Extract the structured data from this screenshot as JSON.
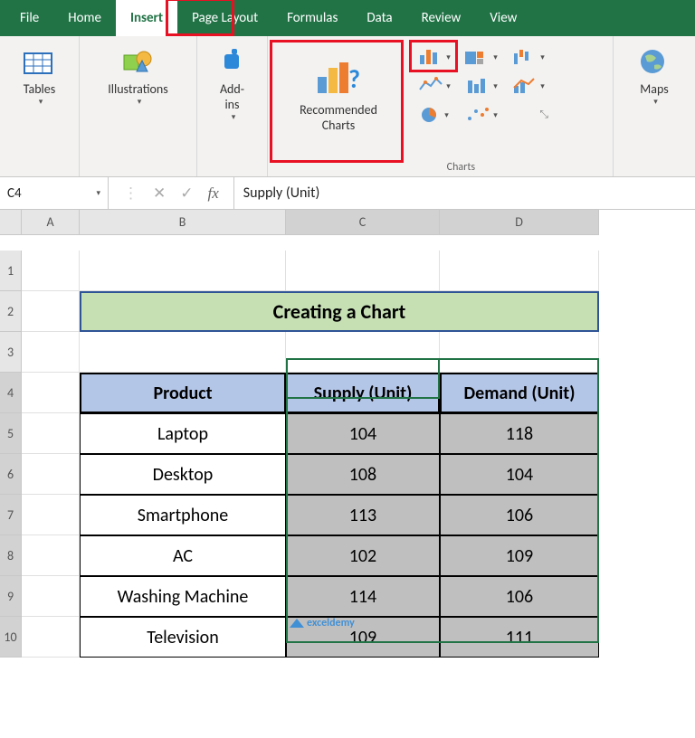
{
  "tabs": [
    "File",
    "Home",
    "Insert",
    "Page Layout",
    "Formulas",
    "Data",
    "Review",
    "View"
  ],
  "activeTab": "Insert",
  "ribbon": {
    "tables": "Tables",
    "illustrations": "Illustrations",
    "addins": "Add-\nins",
    "recCharts": "Recommended\nCharts",
    "maps": "Maps",
    "chartsGroupLabel": "Charts"
  },
  "namebox": "C4",
  "formula": "Supply (Unit)",
  "colHeaders": [
    "A",
    "B",
    "C",
    "D"
  ],
  "rowHeaders": [
    "1",
    "2",
    "3",
    "4",
    "5",
    "6",
    "7",
    "8",
    "9",
    "10"
  ],
  "sheet": {
    "title": "Creating a Chart",
    "headers": [
      "Product",
      "Supply (Unit)",
      "Demand (Unit)"
    ],
    "rows": [
      {
        "p": "Laptop",
        "s": "104",
        "d": "118"
      },
      {
        "p": "Desktop",
        "s": "108",
        "d": "104"
      },
      {
        "p": "Smartphone",
        "s": "113",
        "d": "106"
      },
      {
        "p": "AC",
        "s": "102",
        "d": "109"
      },
      {
        "p": "Washing Machine",
        "s": "114",
        "d": "106"
      },
      {
        "p": "Television",
        "s": "109",
        "d": "111"
      }
    ]
  },
  "watermark": "exceldemy"
}
